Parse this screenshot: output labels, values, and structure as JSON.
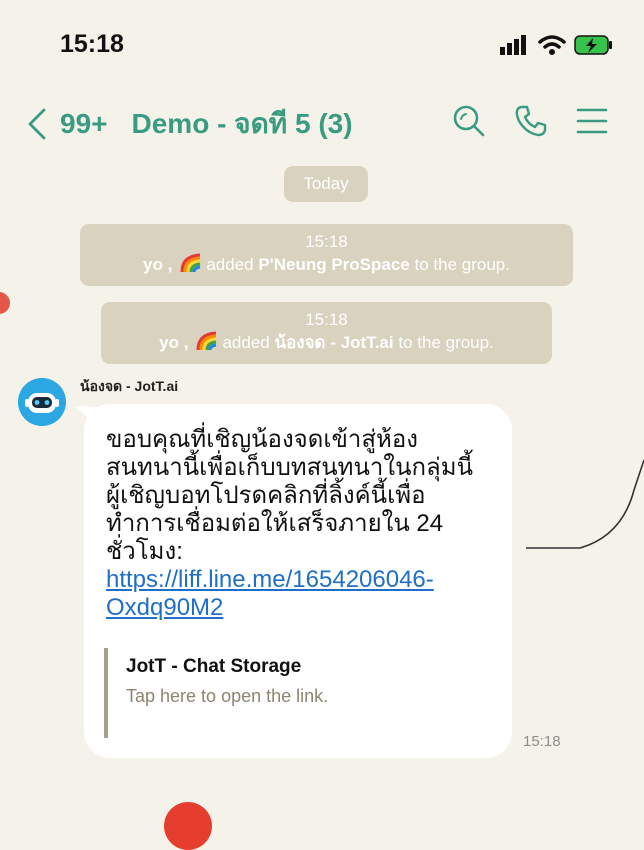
{
  "status": {
    "time": "15:18"
  },
  "nav": {
    "back_count": "99+",
    "title": "Demo - จดที 5 (3)"
  },
  "today_label": "Today",
  "system_messages": [
    {
      "time": "15:18",
      "actor": "yo ,",
      "action": "added",
      "target": "P'Neung ProSpace",
      "suffix": "to the group."
    },
    {
      "time": "15:18",
      "actor": "yo ,",
      "action": "added",
      "target": "น้องจด - JotT.ai",
      "suffix": "to the group."
    }
  ],
  "message": {
    "sender": "น้องจด - JotT.ai",
    "lines": [
      "ขอบคุณที่เชิญน้องจดเข้าสู่ห้อง",
      "สนทนานี้เพื่อเก็บบทสนทนาในกลุ่มนี้",
      "ผู้เชิญบอทโปรดคลิกที่ลิ้งค์นี้เพื่อ",
      "ทำการเชื่อมต่อให้เสร็จภายใน 24",
      "ชั่วโมง:"
    ],
    "link_line1": "https://liff.line.me/1654206046-",
    "link_line2": "Oxdq90M2",
    "preview_title": "JotT - Chat Storage",
    "preview_subtitle": "Tap here to open the link.",
    "time": "15:18"
  },
  "colors": {
    "accent": "#3a9b83",
    "background": "#f5f2e9",
    "system_pill": "#d8d2bf",
    "link": "#1f6fc8"
  },
  "icons": [
    "signal-icon",
    "wifi-icon",
    "battery-charging-icon",
    "back-chevron-icon",
    "search-icon",
    "phone-icon",
    "menu-icon",
    "rainbow-icon",
    "robot-avatar-icon"
  ]
}
